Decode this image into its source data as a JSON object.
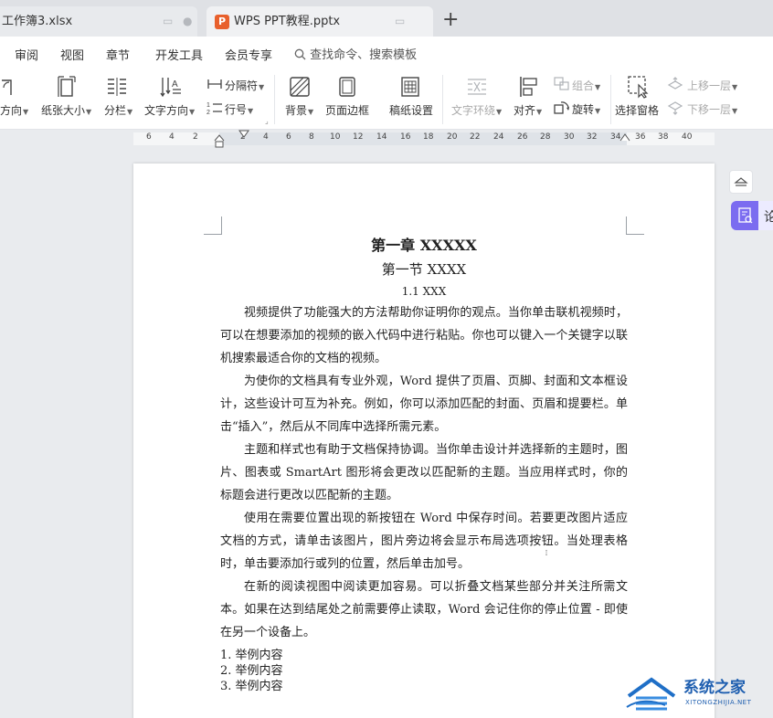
{
  "tabs": [
    {
      "label": "工作簿3.xlsx"
    },
    {
      "label": "WPS PPT教程.pptx",
      "logo": "P"
    }
  ],
  "new_tab": "+",
  "menu": {
    "items": [
      "审阅",
      "视图",
      "章节",
      "开发工具",
      "会员专享"
    ],
    "search": "查找命令、搜索模板"
  },
  "ribbon": {
    "orientation": "方向",
    "paper_size": "纸张大小",
    "columns": "分栏",
    "text_direction": "文字方向",
    "separator": "分隔符",
    "line_number": "行号",
    "background": "背景",
    "page_border": "页面边框",
    "manuscript": "稿纸设置",
    "text_wrap": "文字环绕",
    "align": "对齐",
    "group": "组合",
    "rotate": "旋转",
    "selection_pane": "选择窗格",
    "bring_forward": "上移一层",
    "send_backward": "下移一层"
  },
  "ruler_ticks": [
    "6",
    "4",
    "2",
    "2",
    "4",
    "6",
    "8",
    "10",
    "12",
    "14",
    "16",
    "18",
    "20",
    "22",
    "24",
    "26",
    "28",
    "30",
    "32",
    "34",
    "36",
    "38",
    "40"
  ],
  "doc": {
    "chapter": "第一章  XXXXX",
    "section": "第一节  XXXX",
    "subsection": "1.1 XXX",
    "paragraphs": [
      "视频提供了功能强大的方法帮助你证明你的观点。当你单击联机视频时，可以在想要添加的视频的嵌入代码中进行粘贴。你也可以键入一个关键字以联机搜索最适合你的文档的视频。",
      "为使你的文档具有专业外观，Word 提供了页眉、页脚、封面和文本框设计，这些设计可互为补充。例如，你可以添加匹配的封面、页眉和提要栏。单击“插入”，然后从不同库中选择所需元素。",
      "主题和样式也有助于文档保持协调。当你单击设计并选择新的主题时，图片、图表或 SmartArt 图形将会更改以匹配新的主题。当应用样式时，你的标题会进行更改以匹配新的主题。",
      "使用在需要位置出现的新按钮在 Word 中保存时间。若要更改图片适应文档的方式，请单击该图片，图片旁边将会显示布局选项按钮。当处理表格时，单击要添加行或列的位置，然后单击加号。",
      "在新的阅读视图中阅读更加容易。可以折叠文档某些部分并关注所需文本。如果在达到结尾处之前需要停止读取，Word 会记住你的停止位置 - 即使在另一个设备上。"
    ],
    "list": [
      "1. 举例内容",
      "2. 举例内容",
      "3. 举例内容"
    ]
  },
  "side_label": "论",
  "watermark": {
    "main": "系统之家",
    "sub": "XITONGZHIJIA.NET"
  },
  "colors": {
    "accent": "#7b6cf0",
    "ppt": "#e8602c",
    "watermark": "#1f6fc7"
  }
}
